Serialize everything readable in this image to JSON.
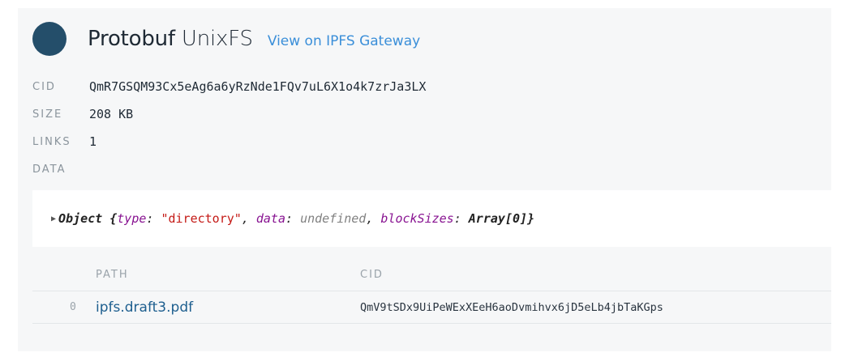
{
  "header": {
    "node_type": "Protobuf",
    "node_format": "UnixFS",
    "gateway_link": "View on IPFS Gateway"
  },
  "meta": {
    "cid_label": "CID",
    "cid_value": "QmR7GSQM93Cx5eAg6a6yRzNde1FQv7uL6X1o4k7zrJa3LX",
    "size_label": "SIZE",
    "size_value": "208 KB",
    "links_label": "LINKS",
    "links_value": "1",
    "data_label": "DATA"
  },
  "data_object": {
    "prefix": "Object {",
    "type_key": "type",
    "type_value": "\"directory\"",
    "data_key": "data",
    "data_value": "undefined",
    "blocksizes_key": "blockSizes",
    "blocksizes_value": "Array[0]",
    "suffix": "}"
  },
  "links_table": {
    "columns": {
      "path": "PATH",
      "cid": "CID"
    },
    "rows": [
      {
        "index": "0",
        "path": "ipfs.draft3.pdf",
        "cid": "QmV9tSDx9UiPeWExXEeH6aoDvmihvx6jD5eLb4jbTaKGps"
      }
    ]
  },
  "colors": {
    "node_dot": "#244e6a",
    "link": "#3b8fd9",
    "panel_bg": "#f6f7f8"
  }
}
